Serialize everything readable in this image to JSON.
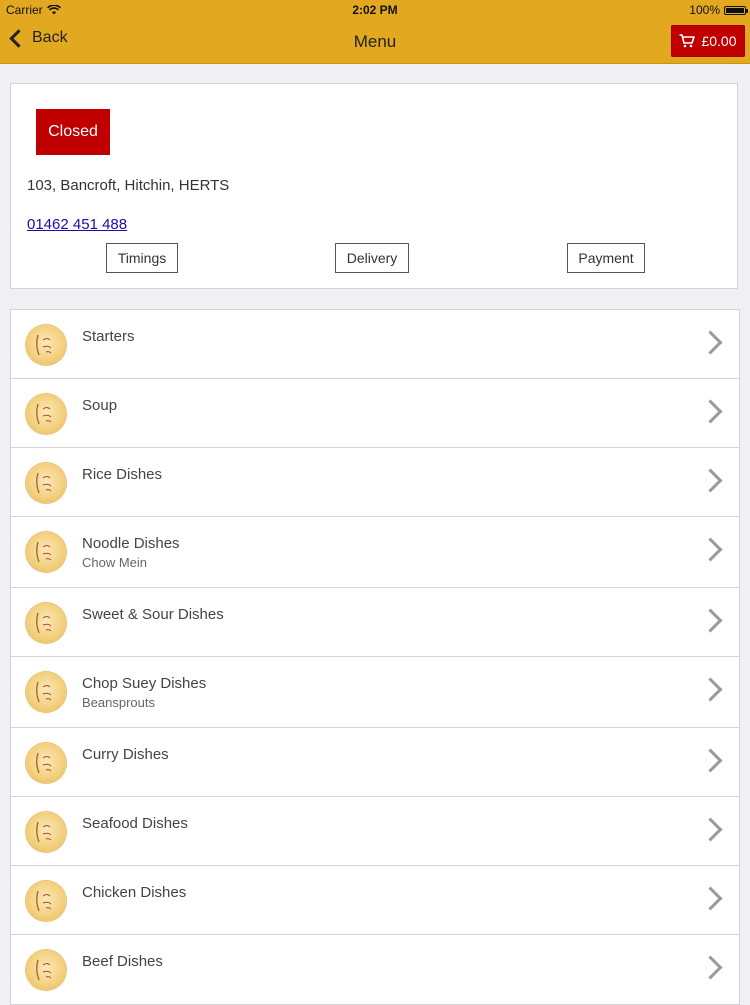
{
  "status_bar": {
    "carrier": "Carrier",
    "time": "2:02 PM",
    "battery": "100%"
  },
  "nav": {
    "back_label": "Back",
    "title": "Menu",
    "cart_total": "£0.00"
  },
  "shop": {
    "status": "Closed",
    "address": "103, Bancroft, Hitchin, HERTS",
    "phone": "01462 451 488",
    "buttons": {
      "timings": "Timings",
      "delivery": "Delivery",
      "payment": "Payment"
    }
  },
  "categories": [
    {
      "title": "Starters",
      "subtitle": ""
    },
    {
      "title": "Soup",
      "subtitle": ""
    },
    {
      "title": "Rice Dishes",
      "subtitle": ""
    },
    {
      "title": "Noodle Dishes",
      "subtitle": "Chow Mein"
    },
    {
      "title": "Sweet & Sour Dishes",
      "subtitle": ""
    },
    {
      "title": "Chop Suey Dishes",
      "subtitle": "Beansprouts"
    },
    {
      "title": "Curry Dishes",
      "subtitle": ""
    },
    {
      "title": "Seafood Dishes",
      "subtitle": ""
    },
    {
      "title": "Chicken Dishes",
      "subtitle": ""
    },
    {
      "title": "Beef Dishes",
      "subtitle": ""
    }
  ],
  "colors": {
    "header": "#e2a81f",
    "accent_red": "#c00000",
    "link": "#1a0dab"
  },
  "icons": {
    "category": "restaurant-logo-icon",
    "row_arrow": "chevron-right-icon"
  }
}
